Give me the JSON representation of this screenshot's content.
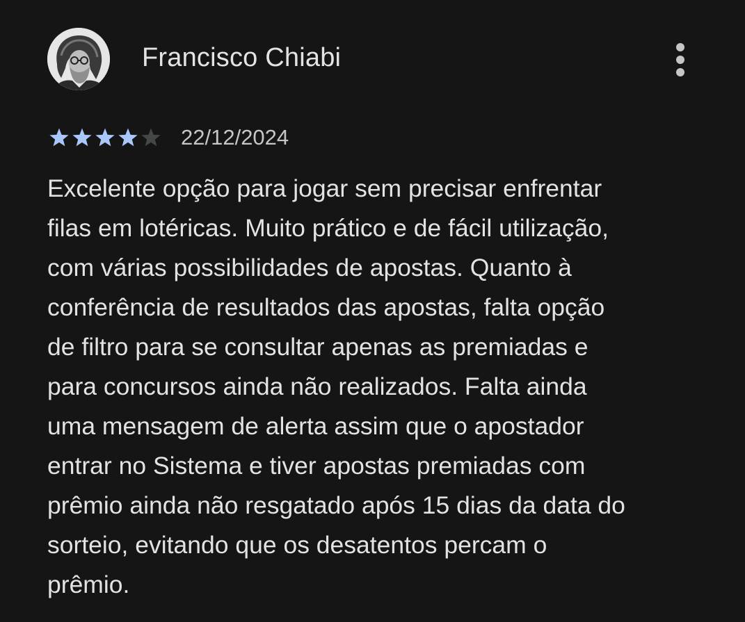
{
  "review": {
    "reviewer_name": "Francisco Chiabi",
    "rating": 4,
    "max_rating": 5,
    "date": "22/12/2024",
    "text_lines": [
      "Excelente opção para jogar sem precisar enfrentar",
      "filas em lotéricas. Muito prático e de fácil utilização,",
      "com várias possibilidades de apostas. Quanto à",
      "conferência de resultados das apostas, falta opção",
      "de filtro para se consultar apenas as premiadas e",
      "para concursos ainda não realizados. Falta ainda",
      "uma mensagem de alerta assim que o apostador",
      "entrar no Sistema e tiver apostas premiadas com",
      "prêmio ainda não resgatado após 15 dias da data do",
      "sorteio, evitando que os desatentos percam o",
      "prêmio."
    ]
  },
  "icons": {
    "more": "more-vert-icon",
    "star": "star-icon"
  },
  "colors": {
    "background": "#151516",
    "text_primary": "#e3e3e3",
    "text_secondary": "#c4c7c5",
    "star_filled": "#a8c7fa",
    "star_empty": "#444746"
  }
}
